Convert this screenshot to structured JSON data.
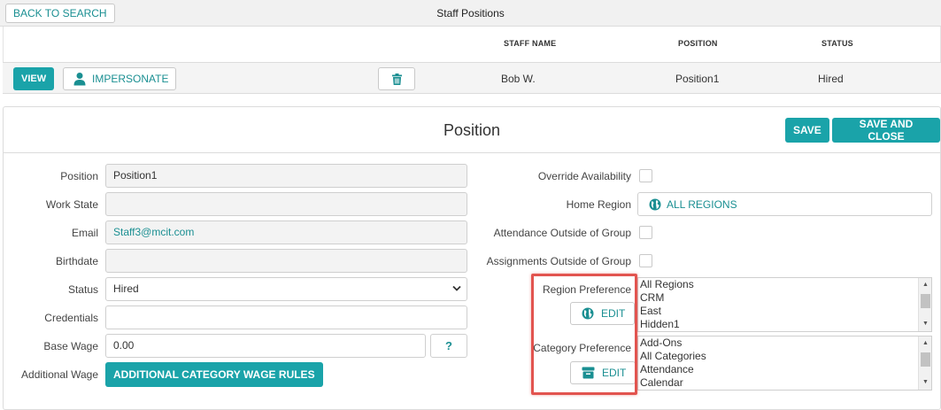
{
  "topbar": {
    "back_label": "BACK TO SEARCH",
    "title": "Staff Positions"
  },
  "table": {
    "headers": {
      "staff_name": "STAFF NAME",
      "position": "POSITION",
      "status": "STATUS"
    },
    "row": {
      "view_label": "VIEW",
      "impersonate_label": "IMPERSONATE",
      "staff_name": "Bob W.",
      "position": "Position1",
      "status": "Hired"
    }
  },
  "panel": {
    "title": "Position",
    "save_label": "SAVE",
    "save_close_label": "SAVE AND CLOSE",
    "left": {
      "position_label": "Position",
      "position_value": "Position1",
      "work_state_label": "Work State",
      "work_state_value": "",
      "email_label": "Email",
      "email_value": "Staff3@mcit.com",
      "birthdate_label": "Birthdate",
      "birthdate_value": "",
      "status_label": "Status",
      "status_value": "Hired",
      "credentials_label": "Credentials",
      "credentials_value": "",
      "base_wage_label": "Base Wage",
      "base_wage_value": "0.00",
      "help_label": "?",
      "additional_wage_label": "Additional Wage",
      "additional_wage_button": "ADDITIONAL CATEGORY WAGE RULES"
    },
    "right": {
      "override_label": "Override Availability",
      "home_region_label": "Home Region",
      "home_region_value": "ALL REGIONS",
      "attendance_label": "Attendance Outside of Group",
      "assignments_label": "Assignments Outside of Group",
      "region_pref_label": "Region Preference",
      "region_edit_label": "EDIT",
      "region_options": [
        "All Regions",
        "CRM",
        "East",
        "Hidden1"
      ],
      "category_pref_label": "Category Preference",
      "category_edit_label": "EDIT",
      "category_options": [
        "Add-Ons",
        "All Categories",
        "Attendance",
        "Calendar"
      ]
    }
  },
  "colors": {
    "accent": "#1aa3a9",
    "accent_text": "#1a8f92",
    "highlight": "#e2544f"
  }
}
